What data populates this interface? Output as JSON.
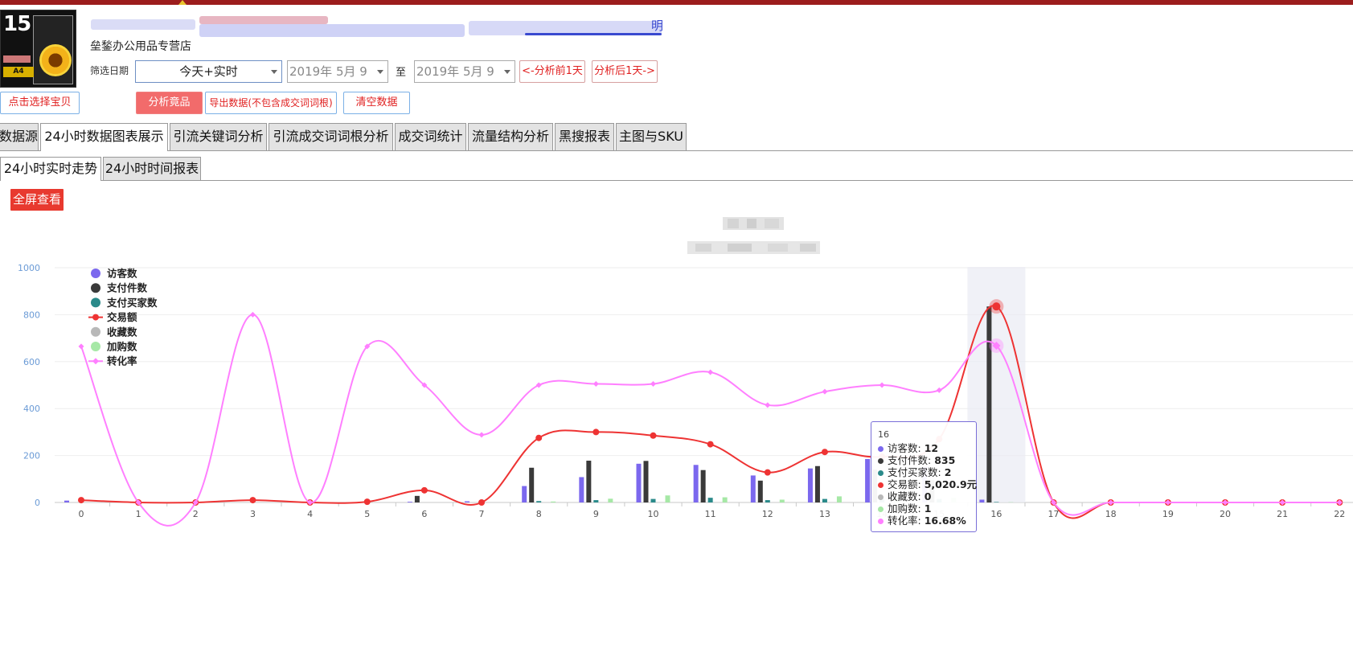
{
  "header": {
    "shop_name": "垒鍫办公用品专营店",
    "title_visible_fragment": "明"
  },
  "thumbnail": {
    "number": "15",
    "tag": "A4"
  },
  "filters": {
    "date_label": "筛选日期",
    "range_value": "今天+实时",
    "from_date": "2019年  5月  9",
    "to_label": "至",
    "to_date": "2019年  5月  9",
    "prev_day": "<-分析前1天",
    "next_day": "分析后1天->"
  },
  "actions": {
    "pick_item": "点击选择宝贝",
    "analyze": "分析竟品",
    "export": "导出数据(不包含成交词词根)",
    "clear": "清空数据"
  },
  "tabs": [
    {
      "label": "数据源"
    },
    {
      "label": "24小时数据图表展示"
    },
    {
      "label": "引流关键词分析"
    },
    {
      "label": "引流成交词词根分析"
    },
    {
      "label": "成交词统计"
    },
    {
      "label": "流量结构分析"
    },
    {
      "label": "黑搜报表"
    },
    {
      "label": "主图与SKU"
    }
  ],
  "subtabs": [
    {
      "label": "24小时实时走势"
    },
    {
      "label": "24小时时间报表"
    }
  ],
  "fullscreen": "全屏查看",
  "colors": {
    "visitors": "#7b68ee",
    "paid_items": "#3a3a3a",
    "buyers": "#2a8a8a",
    "amount": "#ee3333",
    "favorites": "#b8b8b8",
    "cart": "#a6e8a6",
    "conversion": "#ff7fff"
  },
  "chart_data": {
    "type": "bar",
    "x": [
      "0",
      "1",
      "2",
      "3",
      "4",
      "5",
      "6",
      "7",
      "8",
      "9",
      "10",
      "11",
      "12",
      "13",
      "14",
      "15",
      "16",
      "17",
      "18",
      "19",
      "20",
      "21",
      "22"
    ],
    "ylim": [
      0,
      1000
    ],
    "yticks": [
      0,
      200,
      400,
      600,
      800,
      1000
    ],
    "legend_position": "top-left",
    "grid": true,
    "series": [
      {
        "name": "访客数",
        "type": "bar",
        "color": "#7b68ee",
        "values": [
          8,
          0,
          0,
          0,
          0,
          0,
          3,
          5,
          70,
          108,
          165,
          160,
          115,
          145,
          185,
          150,
          12,
          0,
          0,
          0,
          0,
          0,
          0
        ]
      },
      {
        "name": "支付件数",
        "type": "bar",
        "color": "#3a3a3a",
        "values": [
          0,
          0,
          0,
          0,
          0,
          0,
          28,
          0,
          148,
          178,
          177,
          138,
          93,
          155,
          140,
          95,
          835,
          0,
          0,
          0,
          0,
          0,
          0
        ]
      },
      {
        "name": "支付买家数",
        "type": "bar",
        "color": "#2a8a8a",
        "values": [
          0,
          0,
          0,
          0,
          0,
          0,
          0,
          0,
          6,
          10,
          15,
          20,
          10,
          15,
          15,
          15,
          2,
          0,
          0,
          0,
          0,
          0,
          0
        ]
      },
      {
        "name": "交易额",
        "type": "line",
        "color": "#ee3333",
        "values": [
          10,
          0,
          0,
          10,
          0,
          3,
          52,
          0,
          275,
          300,
          285,
          248,
          128,
          215,
          195,
          270,
          835,
          0,
          0,
          0,
          0,
          0,
          0
        ]
      },
      {
        "name": "收藏数",
        "type": "bar",
        "color": "#b8b8b8",
        "values": [
          0,
          0,
          0,
          0,
          0,
          0,
          0,
          0,
          0,
          0,
          0,
          0,
          0,
          0,
          0,
          0,
          0,
          0,
          0,
          0,
          0,
          0,
          0
        ]
      },
      {
        "name": "加购数",
        "type": "bar",
        "color": "#a6e8a6",
        "values": [
          0,
          0,
          0,
          0,
          0,
          0,
          0,
          0,
          4,
          16,
          30,
          22,
          12,
          26,
          20,
          20,
          1,
          0,
          0,
          0,
          0,
          0,
          0
        ]
      },
      {
        "name": "转化率",
        "type": "line",
        "color": "#ff7fff",
        "values": [
          665,
          0,
          0,
          800,
          0,
          665,
          500,
          288,
          500,
          505,
          505,
          555,
          415,
          472,
          500,
          478,
          668,
          0,
          0,
          0,
          0,
          0,
          0
        ]
      }
    ],
    "highlight_index": 16,
    "tooltip": {
      "title": "16",
      "rows": [
        {
          "label": "访客数",
          "value": "12",
          "color": "#7b68ee"
        },
        {
          "label": "支付件数",
          "value": "835",
          "color": "#3a3a3a"
        },
        {
          "label": "支付买家数",
          "value": "2",
          "color": "#2a8a8a"
        },
        {
          "label": "交易额",
          "value": "5,020.9元",
          "color": "#ee3333"
        },
        {
          "label": "收藏数",
          "value": "0",
          "color": "#b8b8b8"
        },
        {
          "label": "加购数",
          "value": "1",
          "color": "#a6e8a6"
        },
        {
          "label": "转化率",
          "value": "16.68%",
          "color": "#ff7fff"
        }
      ]
    }
  }
}
